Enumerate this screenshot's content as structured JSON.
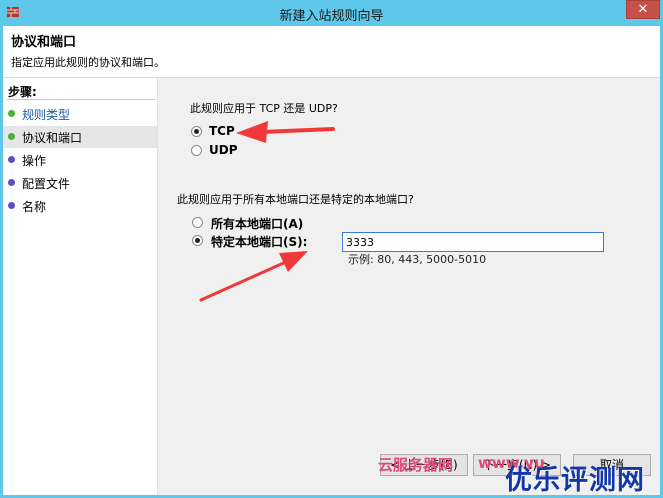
{
  "window": {
    "title": "新建入站规则向导",
    "close_label": "✕"
  },
  "header": {
    "title": "协议和端口",
    "description": "指定应用此规则的协议和端口。"
  },
  "sidebar": {
    "title": "步骤:",
    "items": [
      {
        "label": "规则类型",
        "state": "done"
      },
      {
        "label": "协议和端口",
        "state": "current"
      },
      {
        "label": "操作",
        "state": "todo"
      },
      {
        "label": "配置文件",
        "state": "todo"
      },
      {
        "label": "名称",
        "state": "todo"
      }
    ]
  },
  "protocol": {
    "question": "此规则应用于 TCP 还是 UDP?",
    "options": [
      {
        "label": "TCP",
        "checked": true
      },
      {
        "label": "UDP",
        "checked": false
      }
    ]
  },
  "ports": {
    "question": "此规则应用于所有本地端口还是特定的本地端口?",
    "options": [
      {
        "label": "所有本地端口(A)",
        "checked": false
      },
      {
        "label": "特定本地端口(S):",
        "checked": true
      }
    ],
    "value": "3333",
    "example": "示例: 80, 443, 5000-5010"
  },
  "buttons": {
    "back": "< 上一步(B)",
    "next": "下一步(N) >",
    "cancel": "取消"
  },
  "watermark": {
    "main": "优乐评测网",
    "pink1": "云服务器网",
    "pink2": "www.yu"
  },
  "colors": {
    "window_frame": "#5ec8ea",
    "close_button": "#c7504a",
    "annotation_arrow": "#f03838",
    "watermark_blue": "#1336a8"
  }
}
